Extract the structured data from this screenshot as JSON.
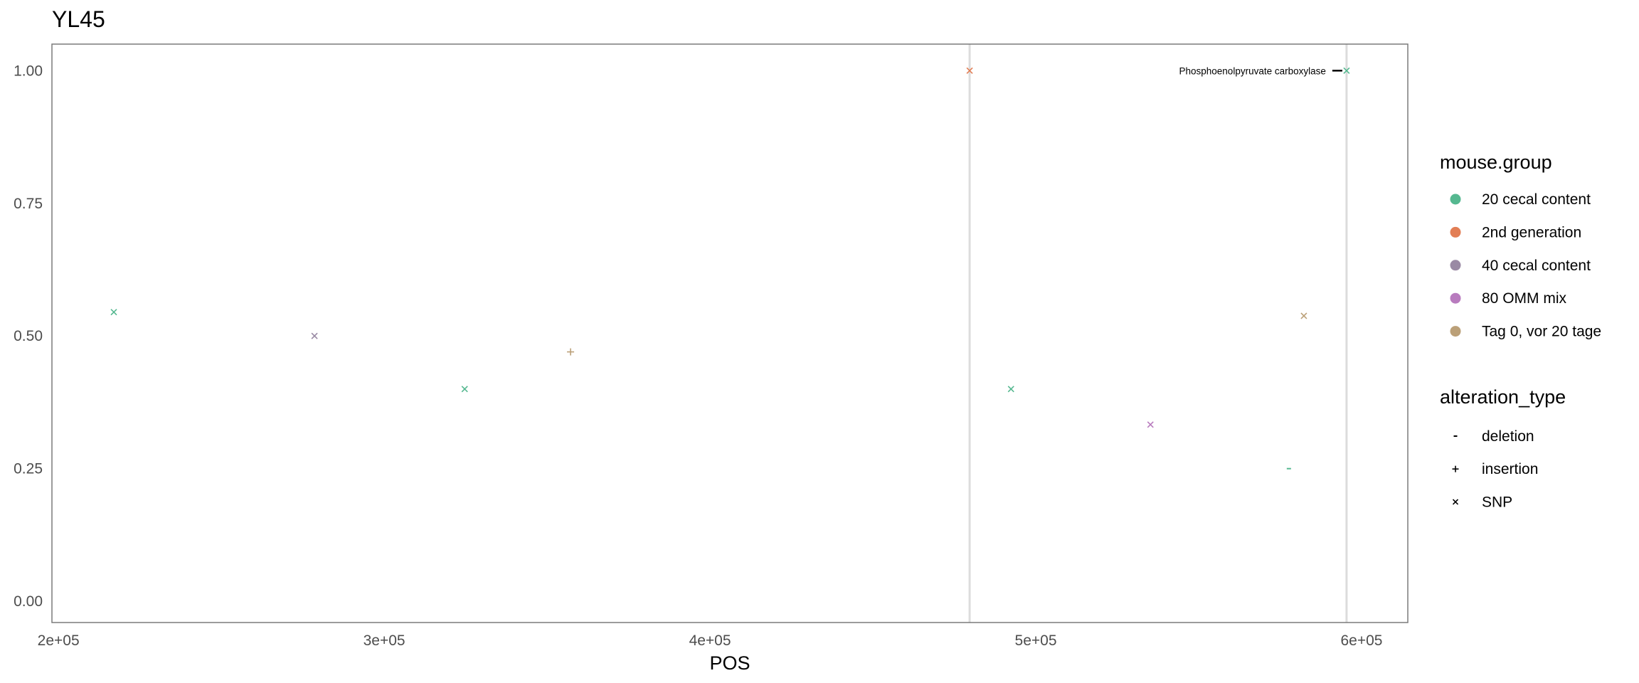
{
  "chart_data": {
    "type": "scatter",
    "title": "YL45",
    "xlabel": "POS",
    "ylabel": "",
    "xlim": [
      198000,
      614200
    ],
    "ylim": [
      -0.04,
      1.05
    ],
    "x_ticks": [
      200000,
      300000,
      400000,
      500000,
      600000
    ],
    "x_tick_labels": [
      "2e+05",
      "3e+05",
      "4e+05",
      "5e+05",
      "6e+05"
    ],
    "y_ticks": [
      0,
      0.25,
      0.5,
      0.75,
      1.0
    ],
    "y_tick_labels": [
      "0.00",
      "0.25",
      "0.50",
      "0.75",
      "1.00"
    ],
    "grid": false,
    "vlines": [
      479700,
      595400
    ],
    "points": [
      {
        "x": 217000,
        "y": 0.545,
        "group": "20 cecal content",
        "type": "SNP"
      },
      {
        "x": 278600,
        "y": 0.5,
        "group": "40 cecal content",
        "type": "SNP"
      },
      {
        "x": 324700,
        "y": 0.4,
        "group": "20 cecal content",
        "type": "SNP"
      },
      {
        "x": 357200,
        "y": 0.47,
        "group": "Tag 0, vor 20 tage",
        "type": "insertion"
      },
      {
        "x": 479700,
        "y": 1.0,
        "group": "2nd generation",
        "type": "SNP"
      },
      {
        "x": 492400,
        "y": 0.4,
        "group": "20 cecal content",
        "type": "SNP"
      },
      {
        "x": 535200,
        "y": 0.333,
        "group": "80 OMM mix",
        "type": "SNP"
      },
      {
        "x": 577700,
        "y": 0.25,
        "group": "20 cecal content",
        "type": "deletion"
      },
      {
        "x": 582300,
        "y": 0.538,
        "group": "Tag 0, vor 20 tage",
        "type": "SNP"
      },
      {
        "x": 595400,
        "y": 1.0,
        "group": "20 cecal content",
        "type": "SNP"
      }
    ],
    "annotations": [
      {
        "text": "Phosphoenolpyruvate carboxylase",
        "x": 595400,
        "y": 1.0
      }
    ],
    "legend_placement": "right",
    "legends": [
      {
        "title": "mouse.group",
        "kind": "color",
        "entries": [
          {
            "label": "20 cecal content",
            "color": "#55b890"
          },
          {
            "label": "2nd generation",
            "color": "#e27e55"
          },
          {
            "label": "40 cecal content",
            "color": "#9a8aa4"
          },
          {
            "label": "80 OMM mix",
            "color": "#b87bbe"
          },
          {
            "label": "Tag 0, vor 20 tage",
            "color": "#bba078"
          }
        ]
      },
      {
        "title": "alteration_type",
        "kind": "shape",
        "entries": [
          {
            "label": "deletion",
            "symbol": "-"
          },
          {
            "label": "insertion",
            "symbol": "+"
          },
          {
            "label": "SNP",
            "symbol": "x"
          }
        ]
      }
    ]
  }
}
